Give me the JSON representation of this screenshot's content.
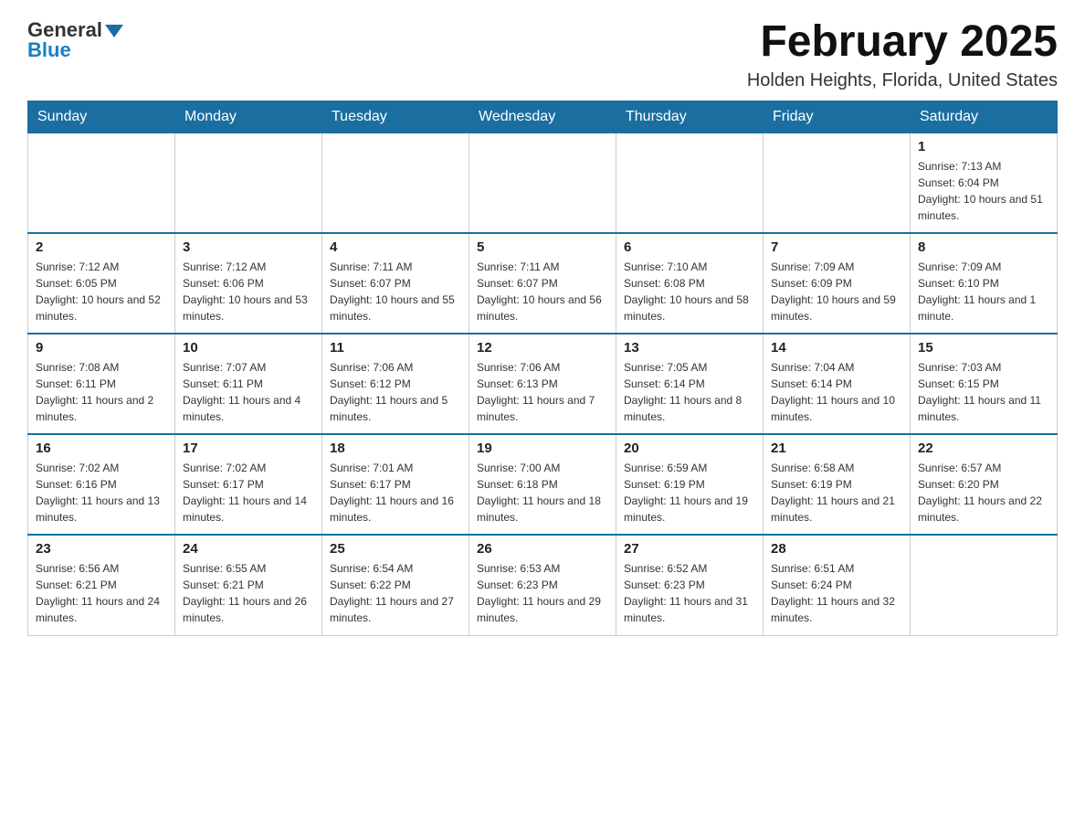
{
  "logo": {
    "general": "General",
    "blue": "Blue"
  },
  "title": "February 2025",
  "subtitle": "Holden Heights, Florida, United States",
  "weekdays": [
    "Sunday",
    "Monday",
    "Tuesday",
    "Wednesday",
    "Thursday",
    "Friday",
    "Saturday"
  ],
  "weeks": [
    [
      {
        "day": "",
        "sunrise": "",
        "sunset": "",
        "daylight": ""
      },
      {
        "day": "",
        "sunrise": "",
        "sunset": "",
        "daylight": ""
      },
      {
        "day": "",
        "sunrise": "",
        "sunset": "",
        "daylight": ""
      },
      {
        "day": "",
        "sunrise": "",
        "sunset": "",
        "daylight": ""
      },
      {
        "day": "",
        "sunrise": "",
        "sunset": "",
        "daylight": ""
      },
      {
        "day": "",
        "sunrise": "",
        "sunset": "",
        "daylight": ""
      },
      {
        "day": "1",
        "sunrise": "Sunrise: 7:13 AM",
        "sunset": "Sunset: 6:04 PM",
        "daylight": "Daylight: 10 hours and 51 minutes."
      }
    ],
    [
      {
        "day": "2",
        "sunrise": "Sunrise: 7:12 AM",
        "sunset": "Sunset: 6:05 PM",
        "daylight": "Daylight: 10 hours and 52 minutes."
      },
      {
        "day": "3",
        "sunrise": "Sunrise: 7:12 AM",
        "sunset": "Sunset: 6:06 PM",
        "daylight": "Daylight: 10 hours and 53 minutes."
      },
      {
        "day": "4",
        "sunrise": "Sunrise: 7:11 AM",
        "sunset": "Sunset: 6:07 PM",
        "daylight": "Daylight: 10 hours and 55 minutes."
      },
      {
        "day": "5",
        "sunrise": "Sunrise: 7:11 AM",
        "sunset": "Sunset: 6:07 PM",
        "daylight": "Daylight: 10 hours and 56 minutes."
      },
      {
        "day": "6",
        "sunrise": "Sunrise: 7:10 AM",
        "sunset": "Sunset: 6:08 PM",
        "daylight": "Daylight: 10 hours and 58 minutes."
      },
      {
        "day": "7",
        "sunrise": "Sunrise: 7:09 AM",
        "sunset": "Sunset: 6:09 PM",
        "daylight": "Daylight: 10 hours and 59 minutes."
      },
      {
        "day": "8",
        "sunrise": "Sunrise: 7:09 AM",
        "sunset": "Sunset: 6:10 PM",
        "daylight": "Daylight: 11 hours and 1 minute."
      }
    ],
    [
      {
        "day": "9",
        "sunrise": "Sunrise: 7:08 AM",
        "sunset": "Sunset: 6:11 PM",
        "daylight": "Daylight: 11 hours and 2 minutes."
      },
      {
        "day": "10",
        "sunrise": "Sunrise: 7:07 AM",
        "sunset": "Sunset: 6:11 PM",
        "daylight": "Daylight: 11 hours and 4 minutes."
      },
      {
        "day": "11",
        "sunrise": "Sunrise: 7:06 AM",
        "sunset": "Sunset: 6:12 PM",
        "daylight": "Daylight: 11 hours and 5 minutes."
      },
      {
        "day": "12",
        "sunrise": "Sunrise: 7:06 AM",
        "sunset": "Sunset: 6:13 PM",
        "daylight": "Daylight: 11 hours and 7 minutes."
      },
      {
        "day": "13",
        "sunrise": "Sunrise: 7:05 AM",
        "sunset": "Sunset: 6:14 PM",
        "daylight": "Daylight: 11 hours and 8 minutes."
      },
      {
        "day": "14",
        "sunrise": "Sunrise: 7:04 AM",
        "sunset": "Sunset: 6:14 PM",
        "daylight": "Daylight: 11 hours and 10 minutes."
      },
      {
        "day": "15",
        "sunrise": "Sunrise: 7:03 AM",
        "sunset": "Sunset: 6:15 PM",
        "daylight": "Daylight: 11 hours and 11 minutes."
      }
    ],
    [
      {
        "day": "16",
        "sunrise": "Sunrise: 7:02 AM",
        "sunset": "Sunset: 6:16 PM",
        "daylight": "Daylight: 11 hours and 13 minutes."
      },
      {
        "day": "17",
        "sunrise": "Sunrise: 7:02 AM",
        "sunset": "Sunset: 6:17 PM",
        "daylight": "Daylight: 11 hours and 14 minutes."
      },
      {
        "day": "18",
        "sunrise": "Sunrise: 7:01 AM",
        "sunset": "Sunset: 6:17 PM",
        "daylight": "Daylight: 11 hours and 16 minutes."
      },
      {
        "day": "19",
        "sunrise": "Sunrise: 7:00 AM",
        "sunset": "Sunset: 6:18 PM",
        "daylight": "Daylight: 11 hours and 18 minutes."
      },
      {
        "day": "20",
        "sunrise": "Sunrise: 6:59 AM",
        "sunset": "Sunset: 6:19 PM",
        "daylight": "Daylight: 11 hours and 19 minutes."
      },
      {
        "day": "21",
        "sunrise": "Sunrise: 6:58 AM",
        "sunset": "Sunset: 6:19 PM",
        "daylight": "Daylight: 11 hours and 21 minutes."
      },
      {
        "day": "22",
        "sunrise": "Sunrise: 6:57 AM",
        "sunset": "Sunset: 6:20 PM",
        "daylight": "Daylight: 11 hours and 22 minutes."
      }
    ],
    [
      {
        "day": "23",
        "sunrise": "Sunrise: 6:56 AM",
        "sunset": "Sunset: 6:21 PM",
        "daylight": "Daylight: 11 hours and 24 minutes."
      },
      {
        "day": "24",
        "sunrise": "Sunrise: 6:55 AM",
        "sunset": "Sunset: 6:21 PM",
        "daylight": "Daylight: 11 hours and 26 minutes."
      },
      {
        "day": "25",
        "sunrise": "Sunrise: 6:54 AM",
        "sunset": "Sunset: 6:22 PM",
        "daylight": "Daylight: 11 hours and 27 minutes."
      },
      {
        "day": "26",
        "sunrise": "Sunrise: 6:53 AM",
        "sunset": "Sunset: 6:23 PM",
        "daylight": "Daylight: 11 hours and 29 minutes."
      },
      {
        "day": "27",
        "sunrise": "Sunrise: 6:52 AM",
        "sunset": "Sunset: 6:23 PM",
        "daylight": "Daylight: 11 hours and 31 minutes."
      },
      {
        "day": "28",
        "sunrise": "Sunrise: 6:51 AM",
        "sunset": "Sunset: 6:24 PM",
        "daylight": "Daylight: 11 hours and 32 minutes."
      },
      {
        "day": "",
        "sunrise": "",
        "sunset": "",
        "daylight": ""
      }
    ]
  ]
}
